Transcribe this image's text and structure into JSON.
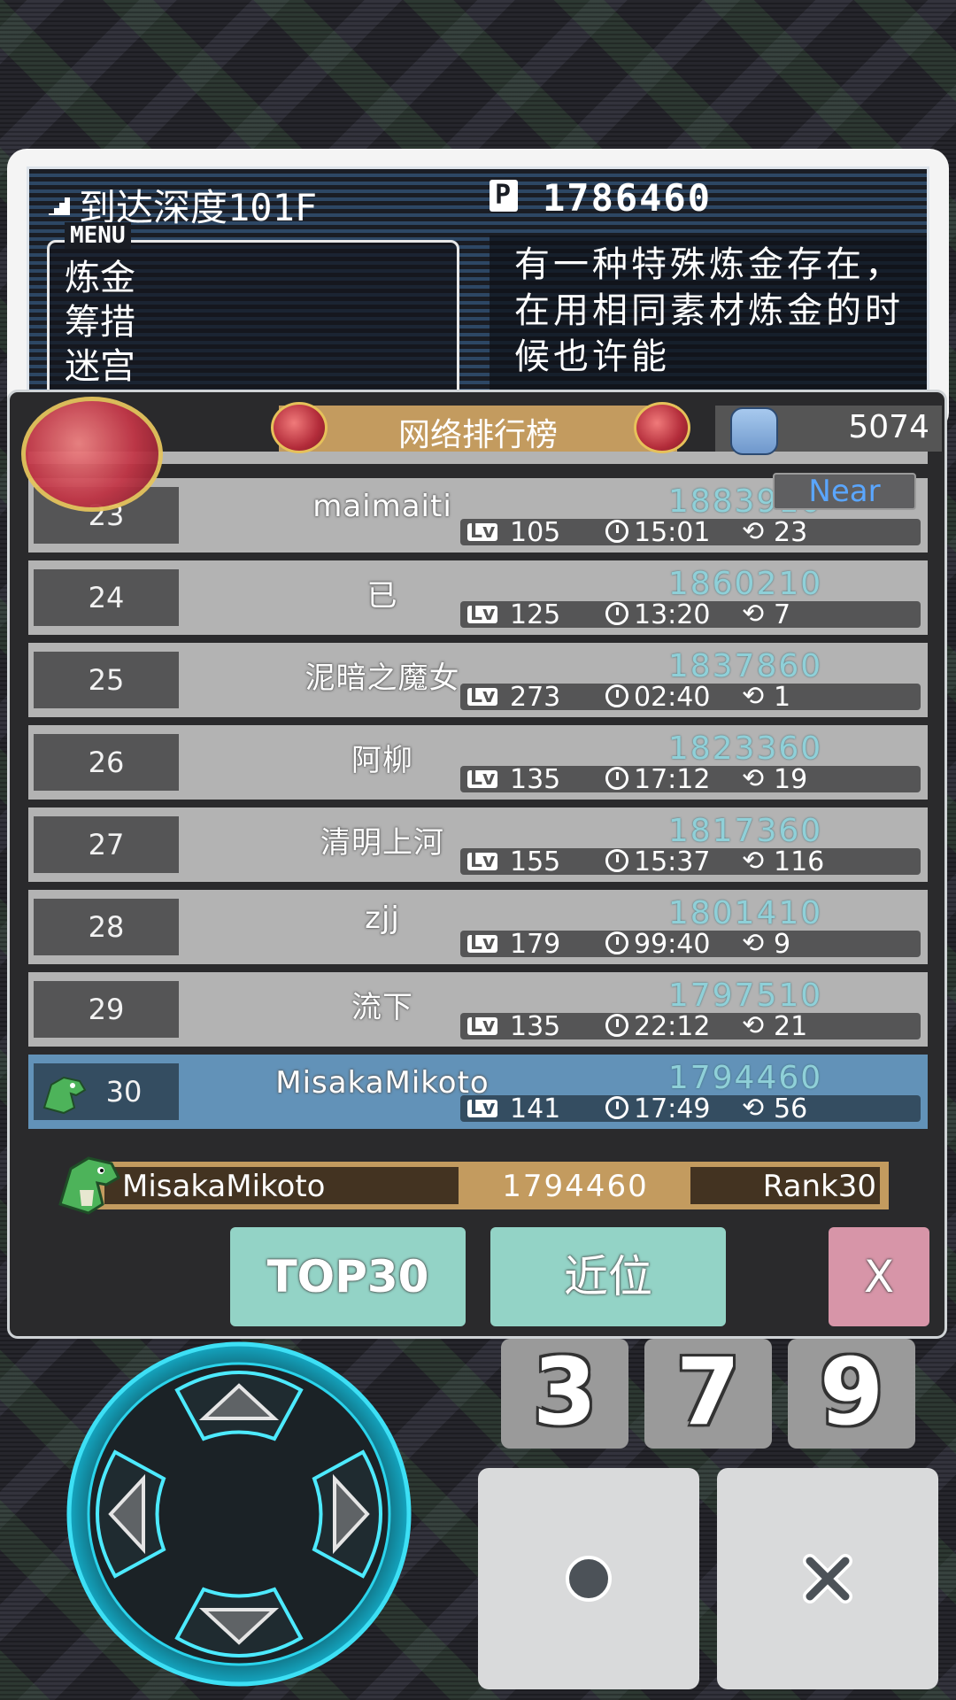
{
  "status": {
    "depth": "到达深度101F",
    "points": "1786460",
    "menu_title": "MENU",
    "menu_items": [
      "炼金",
      "筹措",
      "迷宫"
    ],
    "description": "有一种特殊炼金存在，在用相同素材炼金的时候也许能"
  },
  "ranking": {
    "title": "网络排行榜",
    "players_count": "5074",
    "near_label": "Near",
    "lv_label": "Lv",
    "rows": [
      {
        "rank": "23",
        "name": "maimaiti",
        "score": "1883910",
        "lv": "105",
        "time": "15:01",
        "loops": "23",
        "me": false
      },
      {
        "rank": "24",
        "name": "已",
        "score": "1860210",
        "lv": "125",
        "time": "13:20",
        "loops": "7",
        "me": false
      },
      {
        "rank": "25",
        "name": "泥暗之魔女",
        "score": "1837860",
        "lv": "273",
        "time": "02:40",
        "loops": "1",
        "me": false
      },
      {
        "rank": "26",
        "name": "阿柳",
        "score": "1823360",
        "lv": "135",
        "time": "17:12",
        "loops": "19",
        "me": false
      },
      {
        "rank": "27",
        "name": "清明上河",
        "score": "1817360",
        "lv": "155",
        "time": "15:37",
        "loops": "116",
        "me": false
      },
      {
        "rank": "28",
        "name": "zjj",
        "score": "1801410",
        "lv": "179",
        "time": "99:40",
        "loops": "9",
        "me": false
      },
      {
        "rank": "29",
        "name": "流下",
        "score": "1797510",
        "lv": "135",
        "time": "22:12",
        "loops": "21",
        "me": false
      },
      {
        "rank": "30",
        "name": "MisakaMikoto",
        "score": "1794460",
        "lv": "141",
        "time": "17:49",
        "loops": "56",
        "me": true
      }
    ]
  },
  "self": {
    "name": "MisakaMikoto",
    "score": "1794460",
    "rank": "Rank30"
  },
  "buttons": {
    "top30": "TOP30",
    "near": "近位",
    "close": "X"
  },
  "keys": {
    "k3": "3",
    "k7": "7",
    "k9": "9"
  },
  "colors": {
    "rank_gold": "#c39b5f",
    "row_gray": "#b3b3b3",
    "row_self": "#6292b8",
    "button_teal": "#93d3c6",
    "button_pink": "#d795a8",
    "score_cyan": "#8fd0d8"
  },
  "icons": {
    "dpad": "dpad-icon",
    "ok": "circle-icon",
    "cancel": "cross-icon",
    "crown": "crown-icon",
    "players": "players-icon",
    "avatar": "dino-avatar-icon"
  }
}
